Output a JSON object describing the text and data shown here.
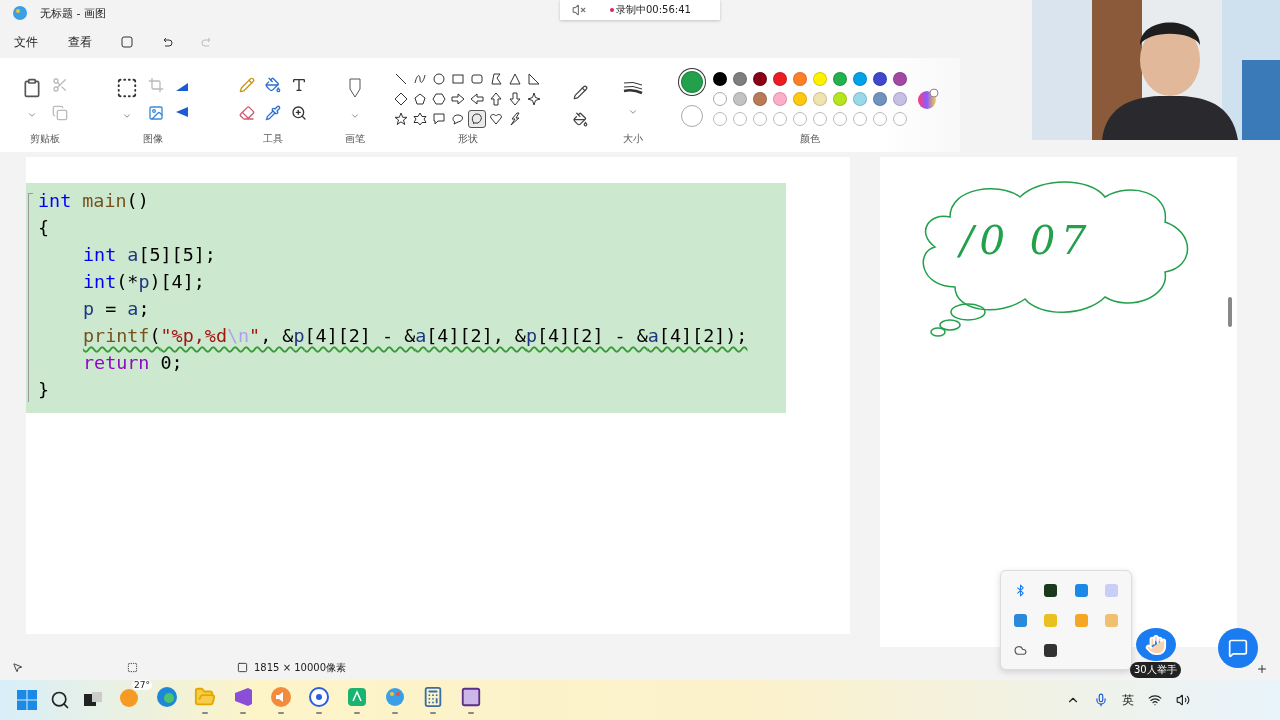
{
  "window": {
    "title": "无标题 - 画图"
  },
  "recording": {
    "text": "录制中00:56:41"
  },
  "menu": [
    "文件",
    "查看"
  ],
  "ribbon": {
    "groups": [
      "剪贴板",
      "图像",
      "工具",
      "画笔",
      "形状",
      "大小",
      "颜色"
    ],
    "shapes": [
      {
        "kind": "line",
        "selected": false
      },
      {
        "kind": "curve",
        "selected": false
      },
      {
        "kind": "oval",
        "selected": false
      },
      {
        "kind": "rect",
        "selected": false
      },
      {
        "kind": "roundrect",
        "selected": false
      },
      {
        "kind": "polygon",
        "selected": false
      },
      {
        "kind": "triangle",
        "selected": false
      },
      {
        "kind": "right-triangle",
        "selected": false
      },
      {
        "kind": "diamond",
        "selected": false
      },
      {
        "kind": "pentagon",
        "selected": false
      },
      {
        "kind": "hexagon",
        "selected": false
      },
      {
        "kind": "arrow-right",
        "selected": false
      },
      {
        "kind": "arrow-left",
        "selected": false
      },
      {
        "kind": "arrow-up",
        "selected": false
      },
      {
        "kind": "arrow-down",
        "selected": false
      },
      {
        "kind": "star4",
        "selected": false
      },
      {
        "kind": "star5",
        "selected": false
      },
      {
        "kind": "star6",
        "selected": false
      },
      {
        "kind": "callout-rect",
        "selected": false
      },
      {
        "kind": "callout-oval",
        "selected": false
      },
      {
        "kind": "callout-round",
        "selected": true
      },
      {
        "kind": "heart",
        "selected": false
      },
      {
        "kind": "lightning",
        "selected": false
      }
    ],
    "primary_color": {
      "color": "#22a04b"
    },
    "secondary_color": {
      "color": "#ffffff"
    },
    "palette": [
      {
        "color": "#000000"
      },
      {
        "color": "#7f7f7f"
      },
      {
        "color": "#880015"
      },
      {
        "color": "#ed1c24"
      },
      {
        "color": "#ff7f27"
      },
      {
        "color": "#fff200"
      },
      {
        "color": "#22b14c"
      },
      {
        "color": "#00a2e8"
      },
      {
        "color": "#3f48cc"
      },
      {
        "color": "#a349a4"
      },
      {
        "color": "#ffffff"
      },
      {
        "color": "#c3c3c3"
      },
      {
        "color": "#b97a57"
      },
      {
        "color": "#ffaec9"
      },
      {
        "color": "#ffc90e"
      },
      {
        "color": "#efe4b0"
      },
      {
        "color": "#b5e61d"
      },
      {
        "color": "#99d9ea"
      },
      {
        "color": "#7092be"
      },
      {
        "color": "#c8bfe7"
      }
    ]
  },
  "code": {
    "lines": [
      {
        "indented": false,
        "squiggle": false,
        "tokens": [
          {
            "kind": "keyword",
            "text": "int"
          },
          {
            "kind": "function",
            "text": " main"
          },
          {
            "kind": "plain",
            "text": "()"
          }
        ]
      },
      {
        "indented": false,
        "squiggle": false,
        "tokens": [
          {
            "kind": "plain",
            "text": "{"
          }
        ]
      },
      {
        "indented": true,
        "squiggle": false,
        "tokens": [
          {
            "kind": "keyword",
            "text": "int"
          },
          {
            "kind": "variable",
            "text": " a"
          },
          {
            "kind": "plain",
            "text": "[5][5];"
          }
        ]
      },
      {
        "indented": true,
        "squiggle": false,
        "tokens": [
          {
            "kind": "keyword",
            "text": "int"
          },
          {
            "kind": "plain",
            "text": "(*"
          },
          {
            "kind": "variable",
            "text": "p"
          },
          {
            "kind": "plain",
            "text": ")[4];"
          }
        ]
      },
      {
        "indented": true,
        "squiggle": false,
        "tokens": [
          {
            "kind": "variable",
            "text": "p"
          },
          {
            "kind": "plain",
            "text": " = "
          },
          {
            "kind": "variable",
            "text": "a"
          },
          {
            "kind": "plain",
            "text": ";"
          }
        ]
      },
      {
        "indented": true,
        "squiggle": true,
        "tokens": [
          {
            "kind": "function",
            "text": "printf"
          },
          {
            "kind": "plain",
            "text": "("
          },
          {
            "kind": "string",
            "text": "\"%p,%d"
          },
          {
            "kind": "escape",
            "text": "\\n"
          },
          {
            "kind": "string",
            "text": "\""
          },
          {
            "kind": "plain",
            "text": ", &"
          },
          {
            "kind": "variable",
            "text": "p"
          },
          {
            "kind": "plain",
            "text": "[4][2] - &"
          },
          {
            "kind": "variable",
            "text": "a"
          },
          {
            "kind": "plain",
            "text": "[4][2], &"
          },
          {
            "kind": "variable",
            "text": "p"
          },
          {
            "kind": "plain",
            "text": "[4][2] - &"
          },
          {
            "kind": "variable",
            "text": "a"
          },
          {
            "kind": "plain",
            "text": "[4][2]);"
          }
        ]
      },
      {
        "indented": true,
        "squiggle": false,
        "tokens": [
          {
            "kind": "control",
            "text": "return"
          },
          {
            "kind": "plain",
            "text": " 0;"
          }
        ]
      },
      {
        "indented": false,
        "squiggle": false,
        "tokens": [
          {
            "kind": "plain",
            "text": "}"
          }
        ]
      }
    ]
  },
  "sketch": {
    "text": "/0 07"
  },
  "status_bar": {
    "canvas_size": "1815 × 10000像素"
  },
  "raise_hand": {
    "label": "30人举手"
  },
  "taskbar": {
    "weather": "27°",
    "apps": [
      {
        "kind": "weather",
        "running": false
      },
      {
        "kind": "browser",
        "running": false
      },
      {
        "kind": "folder",
        "running": true
      },
      {
        "kind": "ide",
        "running": true
      },
      {
        "kind": "audio",
        "running": true
      },
      {
        "kind": "chat",
        "running": true
      },
      {
        "kind": "pdf",
        "running": true
      },
      {
        "kind": "paint",
        "running": true
      },
      {
        "kind": "calculator",
        "running": true
      },
      {
        "kind": "terminal",
        "running": true
      }
    ],
    "input_method": "英"
  }
}
